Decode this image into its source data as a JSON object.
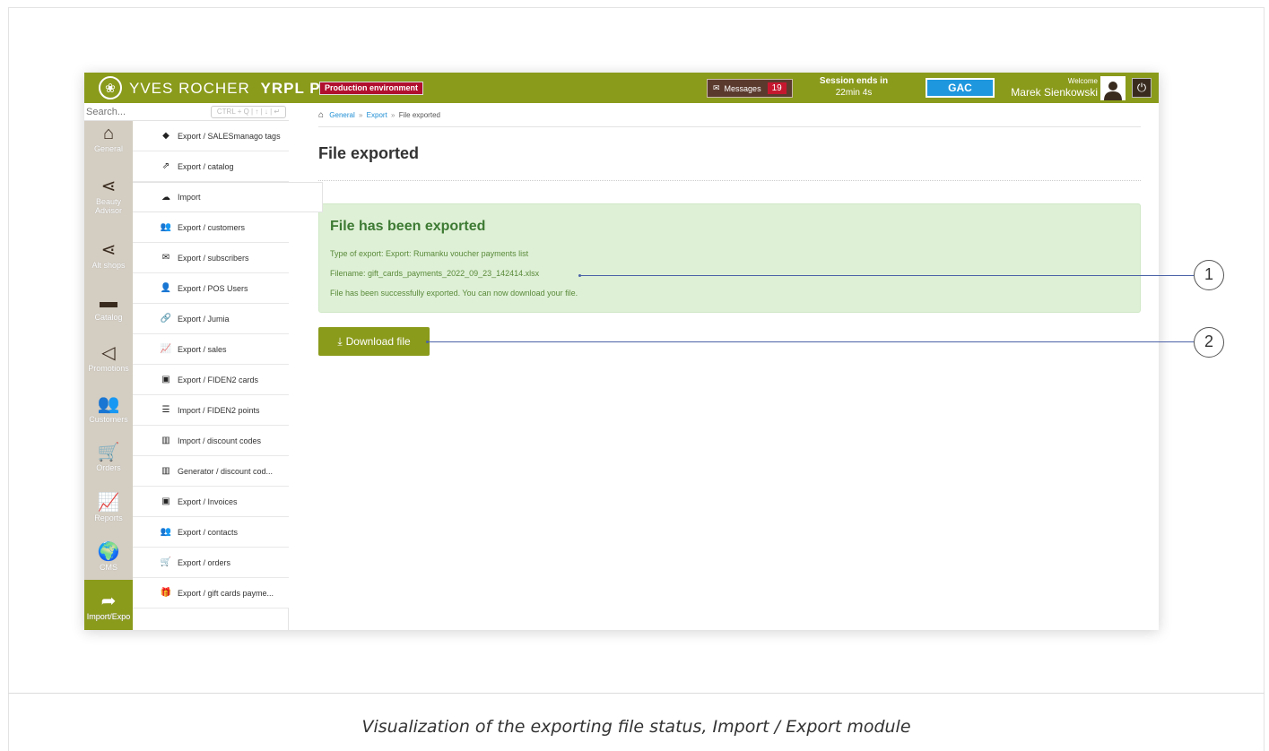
{
  "caption": "Visualization of the exporting file status, Import / Export module",
  "topbar": {
    "brand": "YVES ROCHER",
    "env_code": "YRPL PROD",
    "env_badge": "Production environment",
    "messages_label": "Messages",
    "messages_count": "19",
    "session_title": "Session ends in",
    "session_time": "22min 4s",
    "tenant": "GAC",
    "welcome": "Welcome",
    "user_name": "Marek Sienkowski"
  },
  "search": {
    "placeholder": "Search...",
    "shortcut_hint": "CTRL + Q | ↑ | ↓ | ↵"
  },
  "modules": [
    {
      "label": "General",
      "icon": "home-icon"
    },
    {
      "label": "Beauty Advisor",
      "icon": "share-icon"
    },
    {
      "label": "Alt shops",
      "icon": "share-icon"
    },
    {
      "label": "Catalog",
      "icon": "folder-icon"
    },
    {
      "label": "Promotions",
      "icon": "megaphone-icon"
    },
    {
      "label": "Customers",
      "icon": "users-icon"
    },
    {
      "label": "Orders",
      "icon": "cart-icon"
    },
    {
      "label": "Reports",
      "icon": "chart-icon"
    },
    {
      "label": "CMS",
      "icon": "globe-icon"
    },
    {
      "label": "Import/Expo",
      "icon": "share-arrow-icon",
      "active": true
    }
  ],
  "submenu": [
    {
      "label": "Export / SALESmanago tags",
      "icon": "tag-icon"
    },
    {
      "label": "Export / catalog",
      "icon": "external-link-icon"
    },
    {
      "label": "Import",
      "icon": "cloud-upload-icon",
      "active": true
    },
    {
      "label": "Export / customers",
      "icon": "users-icon"
    },
    {
      "label": "Export / subscribers",
      "icon": "envelope-icon"
    },
    {
      "label": "Export / POS Users",
      "icon": "user-icon"
    },
    {
      "label": "Export / Jumia",
      "icon": "link-icon"
    },
    {
      "label": "Export / sales",
      "icon": "chart-icon"
    },
    {
      "label": "Export / FIDEN2 cards",
      "icon": "card-icon"
    },
    {
      "label": "Import / FIDEN2 points",
      "icon": "list-icon"
    },
    {
      "label": "Import / discount codes",
      "icon": "barcode-icon"
    },
    {
      "label": "Generator / discount cod...",
      "icon": "barcode-icon"
    },
    {
      "label": "Export / Invoices",
      "icon": "card-icon"
    },
    {
      "label": "Export / contacts",
      "icon": "users-icon"
    },
    {
      "label": "Export / orders",
      "icon": "cart-icon"
    },
    {
      "label": "Export / gift cards payme...",
      "icon": "gift-icon"
    }
  ],
  "breadcrumb": {
    "items": [
      "General",
      "Export"
    ],
    "current": "File exported"
  },
  "page_title": "File exported",
  "alert": {
    "title": "File has been exported",
    "type_line": "Type of export: Export: Rumanku voucher payments list",
    "filename_line": "Filename: gift_cards_payments_2022_09_23_142414.xlsx",
    "success_line": "File has been successfully exported. You can now download your file."
  },
  "download_button": "Download file",
  "annotations": [
    "1",
    "2"
  ],
  "colors": {
    "brand_green": "#8a9a1b",
    "alert_bg": "#def0d6",
    "alert_text": "#5a8a3a",
    "prod_red": "#b10f2e",
    "gac_blue": "#1e97de",
    "callout_line": "#4b62a8"
  }
}
